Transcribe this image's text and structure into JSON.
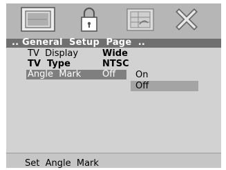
{
  "header": {
    "title": ".. General  Setup  Page  .."
  },
  "tabs": [
    {
      "icon": "general-setup-icon"
    },
    {
      "icon": "lock-icon"
    },
    {
      "icon": "preferences-icon"
    },
    {
      "icon": "exit-icon"
    }
  ],
  "settings": [
    {
      "label": "TV  Display",
      "value": "Wide"
    },
    {
      "label": "TV  Type",
      "value": "NTSC"
    },
    {
      "label": "Angle  Mark",
      "value": "Off"
    }
  ],
  "options": [
    {
      "label": "On"
    },
    {
      "label": "Off"
    }
  ],
  "status": {
    "text": "Set  Angle  Mark"
  },
  "colors": {
    "frame": "#b6b6b6",
    "header_bar": "#6f6f6f",
    "panel": "#d2d2d2",
    "row_highlight": "#7f7f7f",
    "option_highlight": "#a4a4a4"
  }
}
